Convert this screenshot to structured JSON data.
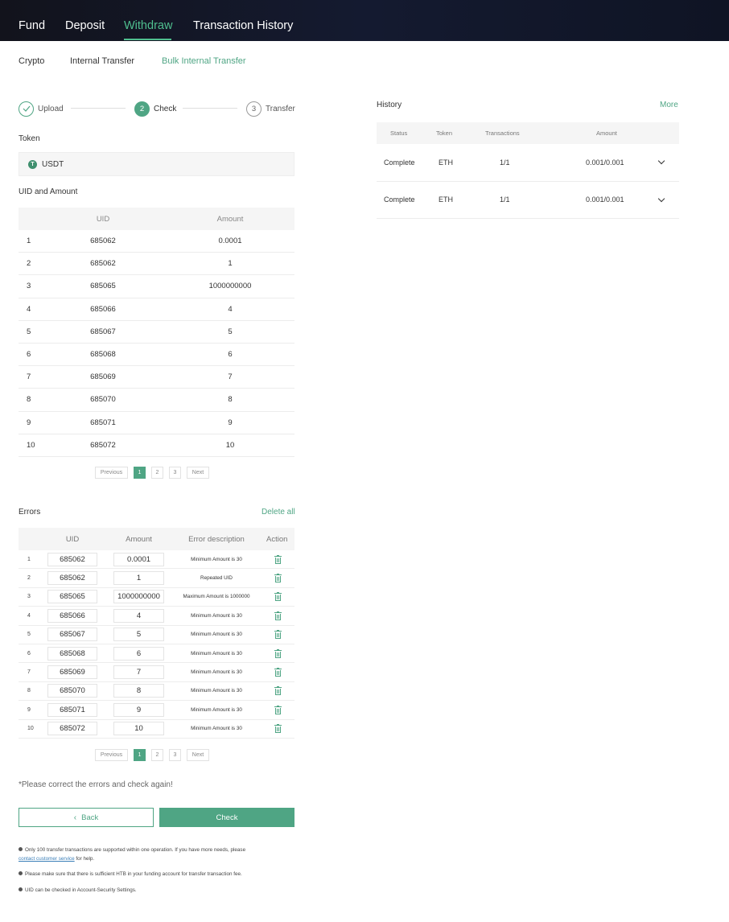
{
  "topnav": {
    "items": [
      "Fund",
      "Deposit",
      "Withdraw",
      "Transaction History"
    ],
    "active": "Withdraw",
    "accent": "#4fbf8f"
  },
  "subnav": {
    "items": [
      "Crypto",
      "Internal Transfer",
      "Bulk Internal Transfer"
    ],
    "active": "Bulk Internal Transfer"
  },
  "stepper": {
    "steps": [
      {
        "marker": "check-icon",
        "label": "Upload",
        "state": "done"
      },
      {
        "marker": "2",
        "label": "Check",
        "state": "current"
      },
      {
        "marker": "3",
        "label": "Transfer",
        "state": "pending"
      }
    ]
  },
  "token": {
    "label": "Token",
    "icon_letter": "T",
    "value": "USDT"
  },
  "uid_amount": {
    "title": "UID and Amount",
    "columns": [
      "UID",
      "Amount"
    ],
    "rows": [
      {
        "idx": "1",
        "uid": "685062",
        "amount": "0.0001"
      },
      {
        "idx": "2",
        "uid": "685062",
        "amount": "1"
      },
      {
        "idx": "3",
        "uid": "685065",
        "amount": "1000000000"
      },
      {
        "idx": "4",
        "uid": "685066",
        "amount": "4"
      },
      {
        "idx": "5",
        "uid": "685067",
        "amount": "5"
      },
      {
        "idx": "6",
        "uid": "685068",
        "amount": "6"
      },
      {
        "idx": "7",
        "uid": "685069",
        "amount": "7"
      },
      {
        "idx": "8",
        "uid": "685070",
        "amount": "8"
      },
      {
        "idx": "9",
        "uid": "685071",
        "amount": "9"
      },
      {
        "idx": "10",
        "uid": "685072",
        "amount": "10"
      }
    ]
  },
  "pagination": {
    "previous": "Previous",
    "pages": [
      "1",
      "2",
      "3"
    ],
    "current": "1",
    "next": "Next"
  },
  "errors": {
    "title": "Errors",
    "delete_all": "Delete all",
    "columns": [
      "UID",
      "Amount",
      "Error description",
      "Action"
    ],
    "rows": [
      {
        "idx": "1",
        "uid": "685062",
        "amount": "0.0001",
        "desc": "Minimum Amount is 30"
      },
      {
        "idx": "2",
        "uid": "685062",
        "amount": "1",
        "desc": "Repeated UID"
      },
      {
        "idx": "3",
        "uid": "685065",
        "amount": "1000000000",
        "desc": "Maximum Amount is 1000000"
      },
      {
        "idx": "4",
        "uid": "685066",
        "amount": "4",
        "desc": "Minimum Amount is 30"
      },
      {
        "idx": "5",
        "uid": "685067",
        "amount": "5",
        "desc": "Minimum Amount is 30"
      },
      {
        "idx": "6",
        "uid": "685068",
        "amount": "6",
        "desc": "Minimum Amount is 30"
      },
      {
        "idx": "7",
        "uid": "685069",
        "amount": "7",
        "desc": "Minimum Amount is 30"
      },
      {
        "idx": "8",
        "uid": "685070",
        "amount": "8",
        "desc": "Minimum Amount is 30"
      },
      {
        "idx": "9",
        "uid": "685071",
        "amount": "9",
        "desc": "Minimum Amount is 30"
      },
      {
        "idx": "10",
        "uid": "685072",
        "amount": "10",
        "desc": "Minimum Amount is 30"
      }
    ]
  },
  "notice": "*Please correct the errors and check again!",
  "buttons": {
    "back": "Back",
    "check": "Check"
  },
  "notes": {
    "n1_text": "Only 100 transfer transactions are supported within one operation. If you have more needs, please",
    "n1_link": "contact customer service",
    "n1_tail": "for help.",
    "n2": "Please make sure that there is sufficient HTB in your funding account for transfer transaction fee.",
    "n3": "UID can be checked in Account-Security Settings."
  },
  "history": {
    "title": "History",
    "more": "More",
    "columns": [
      "Status",
      "Token",
      "Transactions",
      "Amount"
    ],
    "rows": [
      {
        "status": "Complete",
        "token": "ETH",
        "transactions": "1/1",
        "amount": "0.001/0.001"
      },
      {
        "status": "Complete",
        "token": "ETH",
        "transactions": "1/1",
        "amount": "0.001/0.001"
      }
    ]
  },
  "colors": {
    "brand_green": "#4fa584",
    "nav_bg": "#12131c"
  }
}
